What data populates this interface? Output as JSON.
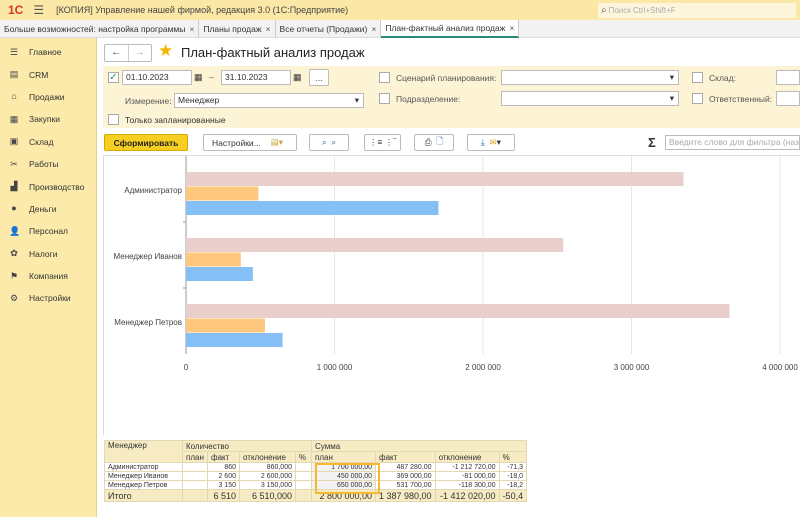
{
  "app": {
    "logo": "1С",
    "title": "[КОПИЯ] Управление нашей фирмой, редакция 3.0  (1С:Предприятие)",
    "search_placeholder": "Поиск Ctrl+Shift+F"
  },
  "tabs": [
    {
      "label": "Больше возможностей: настройка программы",
      "active": false
    },
    {
      "label": "Планы продаж",
      "active": false
    },
    {
      "label": "Все отчеты (Продажи)",
      "active": false
    },
    {
      "label": "План-фактный анализ продаж",
      "active": true
    }
  ],
  "sidebar": [
    {
      "label": "Главное",
      "icon": "menu-icon"
    },
    {
      "label": "CRM",
      "icon": "crm-icon"
    },
    {
      "label": "Продажи",
      "icon": "basket-icon"
    },
    {
      "label": "Закупки",
      "icon": "cart-icon"
    },
    {
      "label": "Склад",
      "icon": "warehouse-icon"
    },
    {
      "label": "Работы",
      "icon": "tools-icon"
    },
    {
      "label": "Производство",
      "icon": "factory-icon"
    },
    {
      "label": "Деньги",
      "icon": "money-icon"
    },
    {
      "label": "Персонал",
      "icon": "people-icon"
    },
    {
      "label": "Налоги",
      "icon": "tax-icon"
    },
    {
      "label": "Компания",
      "icon": "flag-icon"
    },
    {
      "label": "Настройки",
      "icon": "gear-icon"
    }
  ],
  "page": {
    "title": "План-фактный анализ продаж"
  },
  "filters": {
    "date_from": "01.10.2023",
    "date_to": "31.10.2023",
    "period_checked": true,
    "dots": "...",
    "dimension_label": "Измерение:",
    "dimension_value": "Менеджер",
    "only_planned": "Только запланированные",
    "scenario": "Сценарий планирования:",
    "department": "Подразделение:",
    "warehouse": "Склад:",
    "responsible": "Ответственный:"
  },
  "toolbar": {
    "generate": "Сформировать",
    "settings": "Настройки...",
    "filter_placeholder": "Введите слово для фильтра (наз",
    "sigma": "Σ"
  },
  "chart_data": {
    "type": "bar",
    "orientation": "horizontal",
    "categories": [
      "Администратор",
      "Менеджер Иванов",
      "Менеджер Петров"
    ],
    "series": [
      {
        "color": "#e8cfcc",
        "values": [
          3350000,
          2540000,
          3660000
        ]
      },
      {
        "color": "#fdc77e",
        "values": [
          487280,
          369000,
          531700
        ]
      },
      {
        "color": "#84bff6",
        "values": [
          1700000,
          450000,
          650000
        ]
      }
    ],
    "xlim": [
      0,
      4000000
    ],
    "xticks": [
      "0",
      "1 000 000",
      "2 000 000",
      "3 000 000",
      "4 000 000"
    ],
    "grid": true
  },
  "table": {
    "headers": {
      "manager": "Менеджер",
      "qty": "Количество",
      "sum": "Сумма",
      "plan": "план",
      "fact": "факт",
      "dev": "отклонение",
      "pct": "%"
    },
    "rows": [
      {
        "name": "Администратор",
        "qplan": "",
        "qfact": "860",
        "qdev": "860,000",
        "qpct": "",
        "splan": "1 700 000,00",
        "sfact": "487 280,00",
        "sdev": "-1 212 720,00",
        "spct": "-71,3"
      },
      {
        "name": "Менеджер Иванов",
        "qplan": "",
        "qfact": "2 600",
        "qdev": "2 600,000",
        "qpct": "",
        "splan": "450 000,00",
        "sfact": "369 000,00",
        "sdev": "-81 000,00",
        "spct": "-18,0"
      },
      {
        "name": "Менеджер Петров",
        "qplan": "",
        "qfact": "3 150",
        "qdev": "3 150,000",
        "qpct": "",
        "splan": "650 000,00",
        "sfact": "531 700,00",
        "sdev": "-118 300,00",
        "spct": "-18,2"
      }
    ],
    "total": {
      "name": "Итого",
      "qplan": "",
      "qfact": "6 510",
      "qdev": "6 510,000",
      "qpct": "",
      "splan": "2 800 000,00",
      "sfact": "1 387 980,00",
      "sdev": "-1 412 020,00",
      "spct": "-50,4"
    }
  }
}
